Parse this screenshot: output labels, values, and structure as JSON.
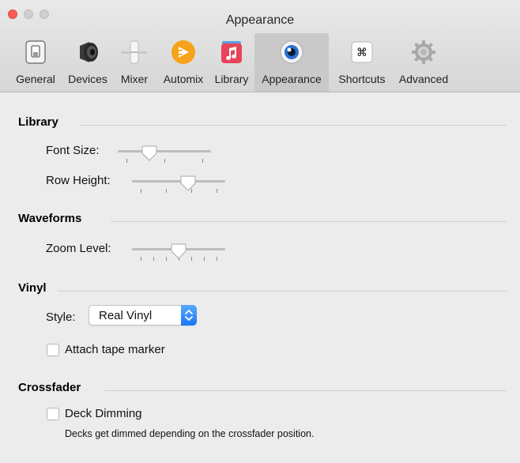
{
  "window": {
    "title": "Appearance"
  },
  "toolbar": {
    "tabs": [
      {
        "label": "General",
        "icon": "general-icon"
      },
      {
        "label": "Devices",
        "icon": "speaker-icon"
      },
      {
        "label": "Mixer",
        "icon": "mixer-icon"
      },
      {
        "label": "Automix",
        "icon": "automix-icon"
      },
      {
        "label": "Library",
        "icon": "library-icon"
      },
      {
        "label": "Appearance",
        "icon": "eye-icon",
        "selected": true
      },
      {
        "label": "Shortcuts",
        "icon": "command-icon",
        "glyph": "⌘"
      },
      {
        "label": "Advanced",
        "icon": "gear-icon"
      }
    ]
  },
  "library": {
    "header": "Library",
    "font_size": {
      "label": "Font Size:",
      "ticks": 3,
      "level": 0.3
    },
    "row_height": {
      "label": "Row Height:",
      "ticks": 4,
      "level": 0.625
    }
  },
  "waveforms": {
    "header": "Waveforms",
    "zoom_level": {
      "label": "Zoom Level:",
      "ticks": 7,
      "level": 0.5
    }
  },
  "vinyl": {
    "header": "Vinyl",
    "style_label": "Style:",
    "style_value": "Real Vinyl",
    "attach_tape_marker": {
      "label": "Attach tape marker",
      "checked": false
    }
  },
  "crossfader": {
    "header": "Crossfader",
    "deck_dimming": {
      "label": "Deck Dimming",
      "checked": false
    },
    "help": "Decks get dimmed depending on the crossfader position."
  },
  "colors": {
    "accent": "#1a7cf5",
    "close": "#fc5b57",
    "selected_tab": "#c9c9c9"
  }
}
